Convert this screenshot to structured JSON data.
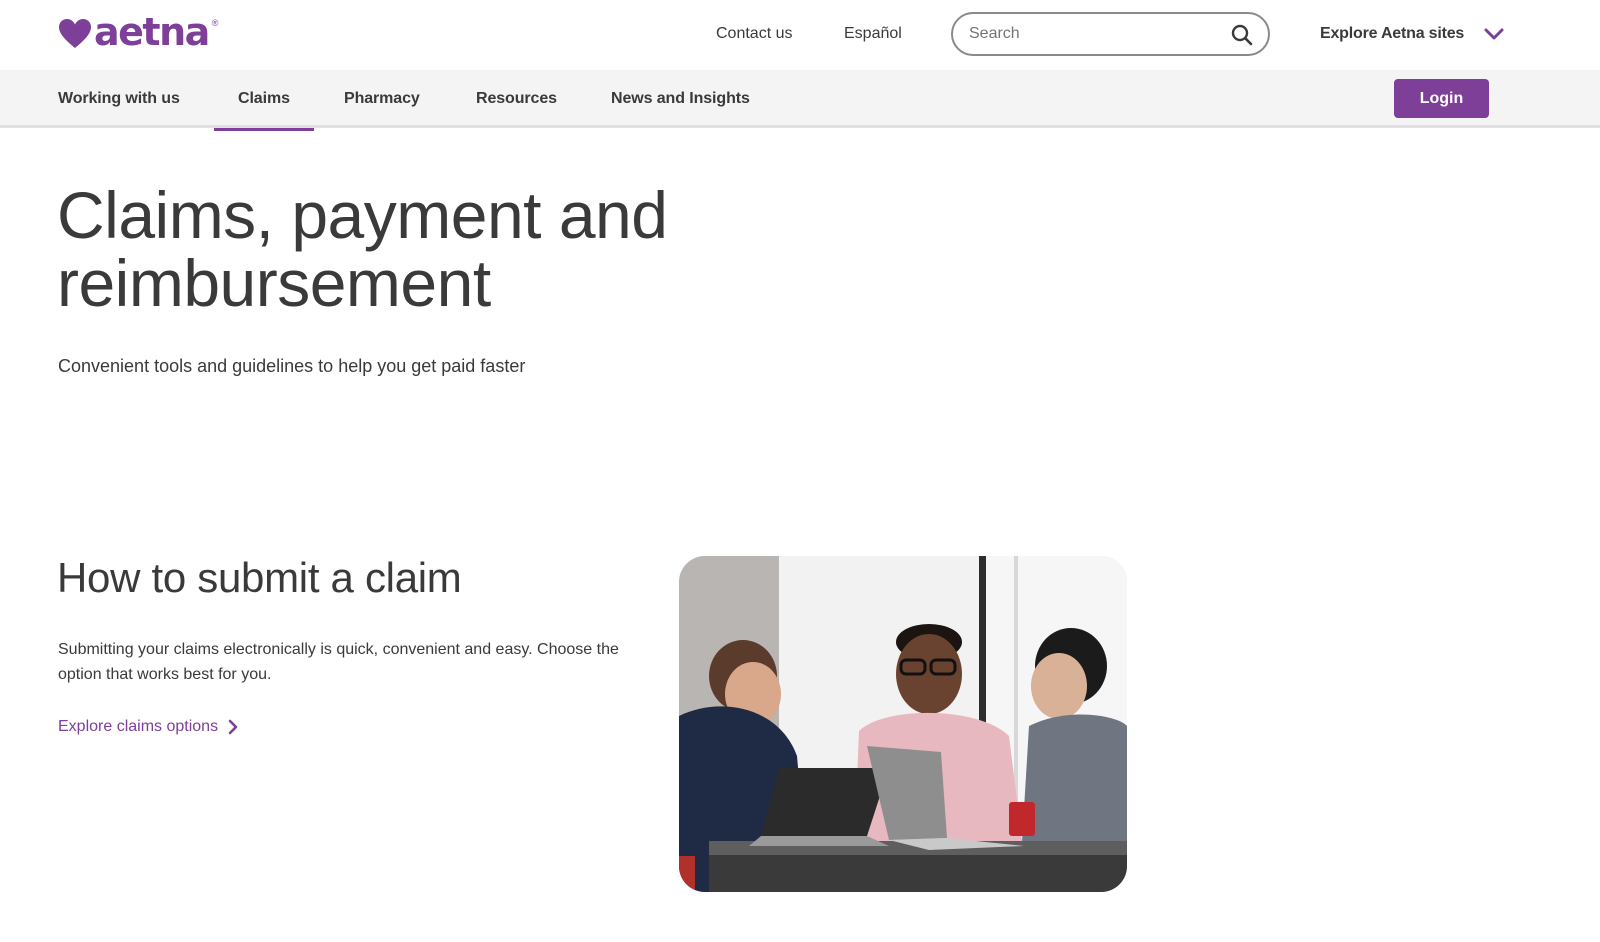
{
  "brand": {
    "logo_text": "aetna",
    "logo_reg": "®",
    "accent_color": "#7d3f98"
  },
  "utility": {
    "contact_label": "Contact us",
    "espanol_label": "Español",
    "search_placeholder": "Search",
    "search_icon": "search-icon",
    "explore_sites_label": "Explore Aetna sites",
    "explore_sites_icon": "chevron-down-icon"
  },
  "nav": {
    "items": [
      {
        "label": "Working with us",
        "active": false
      },
      {
        "label": "Claims",
        "active": true
      },
      {
        "label": "Pharmacy",
        "active": false
      },
      {
        "label": "Resources",
        "active": false
      },
      {
        "label": "News and Insights",
        "active": false
      }
    ],
    "login_label": "Login"
  },
  "hero": {
    "title": "Claims, payment and reimbursement",
    "subtitle": "Convenient tools and guidelines to help you get paid faster"
  },
  "claim_section": {
    "title": "How to submit a claim",
    "body": "Submitting your claims electronically is quick, convenient and easy. Choose the option that works best for you.",
    "link_label": "Explore claims options",
    "link_icon": "chevron-right-icon"
  }
}
